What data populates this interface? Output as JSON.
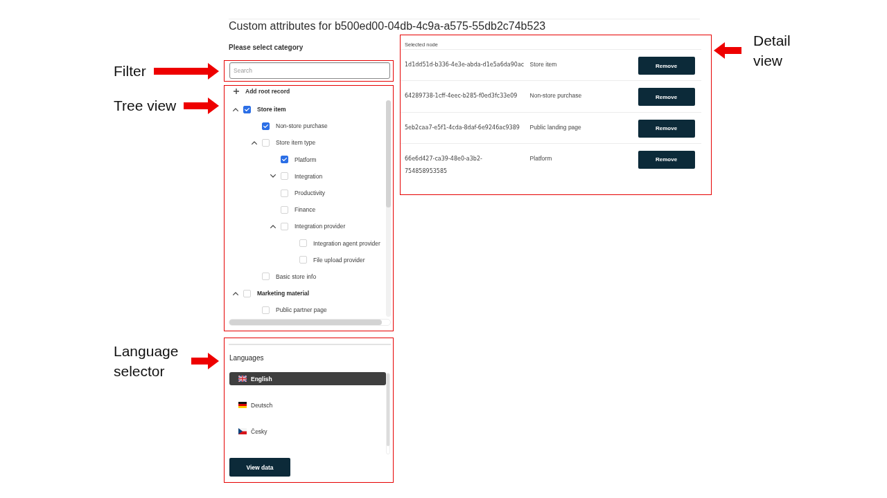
{
  "page": {
    "title": "Custom attributes for b500ed00-04db-4c9a-a575-55db2c74b523"
  },
  "category": {
    "heading": "Please select category"
  },
  "filter": {
    "callout": "Filter",
    "search": {
      "placeholder": "Search"
    }
  },
  "tree": {
    "callout": "Tree view",
    "add_root": "Add root record",
    "nodes": [
      {
        "label": "Store item",
        "checked": true,
        "expanded": true,
        "children": [
          {
            "label": "Non-store purchase",
            "checked": true
          },
          {
            "label": "Store item type",
            "checked": false,
            "expanded": true,
            "children": [
              {
                "label": "Platform",
                "checked": true
              },
              {
                "label": "Integration",
                "checked": false,
                "expanded": false
              },
              {
                "label": "Productivity",
                "checked": false
              },
              {
                "label": "Finance",
                "checked": false
              },
              {
                "label": "Integration provider",
                "checked": false,
                "expanded": true,
                "children": [
                  {
                    "label": "Integration agent provider",
                    "checked": false
                  },
                  {
                    "label": "File upload provider",
                    "checked": false
                  }
                ]
              }
            ]
          },
          {
            "label": "Basic store info",
            "checked": false
          }
        ]
      },
      {
        "label": "Marketing material",
        "checked": false,
        "expanded": true,
        "children": [
          {
            "label": "Public partner page",
            "checked": false
          }
        ]
      }
    ]
  },
  "languages": {
    "callout": "Language selector",
    "heading": "Languages",
    "items": [
      {
        "label": "English",
        "kind": "gb",
        "selected": true
      },
      {
        "label": "Deutsch",
        "kind": "de",
        "selected": false
      },
      {
        "label": "Česky",
        "kind": "cz",
        "selected": false
      }
    ],
    "button": "View data"
  },
  "detail": {
    "callout": "Detail view",
    "heading": "Selected node",
    "rows": [
      {
        "id": "1d1dd51d-b336-4e3e-abda-d1e5a6da90ac",
        "name": "Store item",
        "button": "Remove"
      },
      {
        "id": "64289738-1cff-4eec-b285-f0ed3fc33e09",
        "name": "Non-store purchase",
        "button": "Remove"
      },
      {
        "id": "5eb2caa7-e5f1-4cda-8daf-6e9246ac9389",
        "name": "Public landing page",
        "button": "Remove"
      },
      {
        "id": "66e6d427-ca39-48e0-a3b2-754858953585",
        "name": "Platform",
        "button": "Remove"
      }
    ]
  }
}
